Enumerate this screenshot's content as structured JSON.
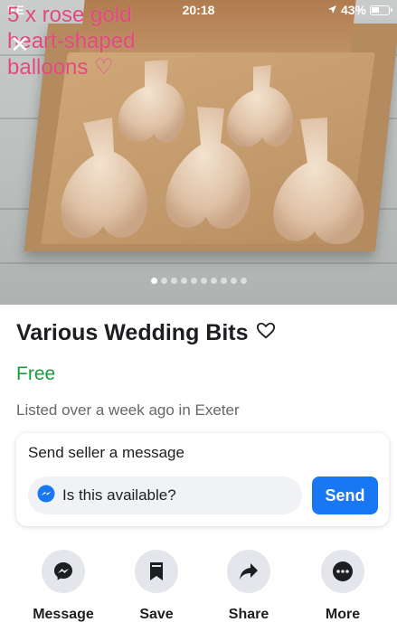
{
  "status_bar": {
    "carrier": "EE",
    "time": "20:18",
    "battery": "43%"
  },
  "photo": {
    "overlay_text": "5 x rose gold heart-shaped balloons ♡",
    "dot_count": 10,
    "active_dot": 0
  },
  "listing": {
    "title": "Various Wedding Bits",
    "price": "Free",
    "listed": "Listed over a week ago in Exeter"
  },
  "message": {
    "heading": "Send seller a message",
    "input_value": "Is this available?",
    "send_label": "Send"
  },
  "actions": [
    {
      "label": "Message",
      "icon": "messenger-icon"
    },
    {
      "label": "Save",
      "icon": "bookmark-icon"
    },
    {
      "label": "Share",
      "icon": "share-arrow-icon"
    },
    {
      "label": "More",
      "icon": "more-dots-icon"
    }
  ],
  "colors": {
    "accent": "#1877f2",
    "price": "#1a9c3c",
    "overlay_text": "#e0487f"
  }
}
